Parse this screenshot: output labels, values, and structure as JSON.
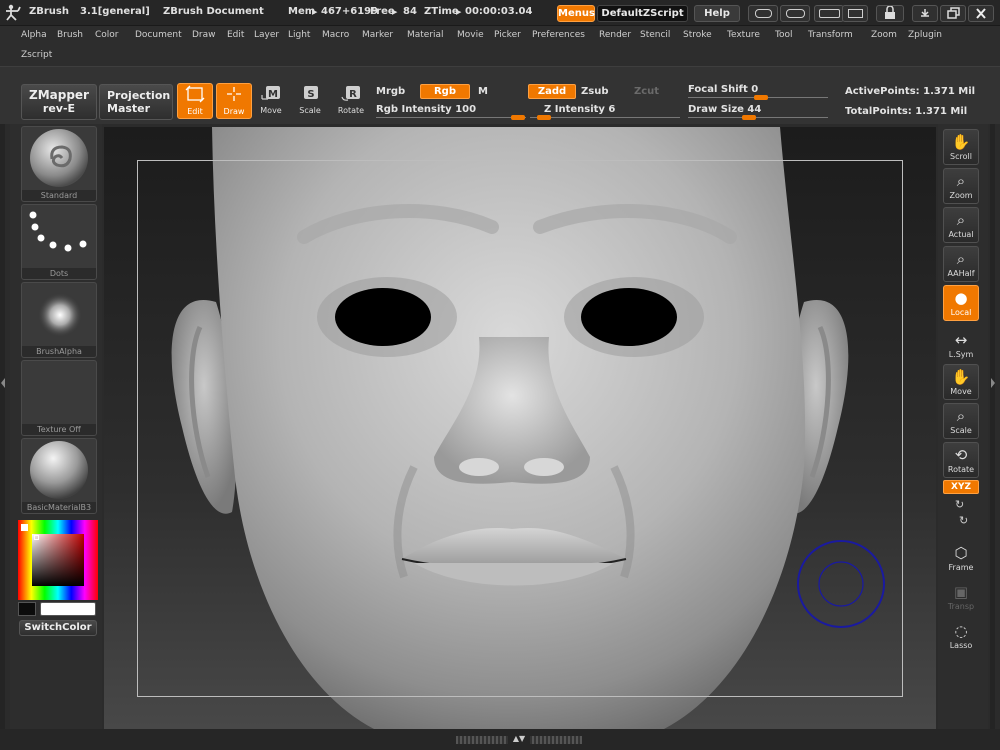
{
  "titlebar": {
    "app": "ZBrush",
    "version": "3.1[general]",
    "document": "ZBrush Document",
    "mem_label": "Mem",
    "mem_value": "467+6199",
    "free_label": "Free",
    "free_value": "84",
    "ztime_label": "ZTime",
    "ztime_value": "00:00:03.04",
    "menus_btn": "Menus",
    "script_btn": "DefaultZScript",
    "help_btn": "Help"
  },
  "menu": {
    "items": [
      "Alpha",
      "Brush",
      "Color",
      "Document",
      "Draw",
      "Edit",
      "Layer",
      "Light",
      "Macro",
      "Marker",
      "Material",
      "Movie",
      "Picker",
      "Preferences",
      "Render",
      "Stencil",
      "Stroke",
      "Texture",
      "Tool",
      "Transform",
      "Zoom",
      "Zplugin",
      "Zscript"
    ]
  },
  "shelf": {
    "zmapper": {
      "line1": "ZMapper",
      "line2": "rev-E"
    },
    "projection": {
      "line1": "Projection",
      "line2": "Master"
    },
    "tools": [
      {
        "label": "Edit",
        "active": true,
        "glyph": "✎"
      },
      {
        "label": "Draw",
        "active": true,
        "glyph": "✛"
      },
      {
        "label": "Move",
        "active": false,
        "glyph": "M"
      },
      {
        "label": "Scale",
        "active": false,
        "glyph": "S"
      },
      {
        "label": "Rotate",
        "active": false,
        "glyph": "R"
      }
    ],
    "mrgb": "Mrgb",
    "rgb": "Rgb",
    "m": "M",
    "rgb_intensity_label": "Rgb Intensity",
    "rgb_intensity_value": "100",
    "zadd": "Zadd",
    "zsub": "Zsub",
    "zcut": "Zcut",
    "z_intensity_label": "Z Intensity",
    "z_intensity_value": "6",
    "focal_shift_label": "Focal Shift",
    "focal_shift_value": "0",
    "draw_size_label": "Draw Size",
    "draw_size_value": "44",
    "active_points_label": "ActivePoints:",
    "active_points_value": "1.371 Mil",
    "total_points_label": "TotalPoints:",
    "total_points_value": "1.371 Mil"
  },
  "left": {
    "thumbs": [
      "Standard",
      "Dots",
      "BrushAlpha",
      "Texture Off",
      "BasicMaterialB3"
    ],
    "switch_color": "SwitchColor",
    "colors": {
      "main": "#0c0c0c",
      "secondary": "#ffffff",
      "picked": "#9a1010"
    }
  },
  "right": {
    "tools": [
      {
        "label": "Scroll",
        "icon": "hand-scroll-icon",
        "state": "normal"
      },
      {
        "label": "Zoom",
        "icon": "zoom-icon",
        "state": "normal"
      },
      {
        "label": "Actual",
        "icon": "actual-size-icon",
        "state": "normal"
      },
      {
        "label": "AAHalf",
        "icon": "aahalf-icon",
        "state": "normal"
      },
      {
        "label": "Local",
        "icon": "local-icon",
        "state": "active"
      },
      {
        "label": "L.Sym",
        "icon": "local-symmetry-icon",
        "state": "plain"
      },
      {
        "label": "Move",
        "icon": "move-icon",
        "state": "normal"
      },
      {
        "label": "Scale",
        "icon": "scale-icon",
        "state": "normal"
      },
      {
        "label": "Rotate",
        "icon": "rotate-icon",
        "state": "normal"
      },
      {
        "label": "Frame",
        "icon": "frame-icon",
        "state": "plain"
      },
      {
        "label": "Transp",
        "icon": "transparency-icon",
        "state": "disabled"
      },
      {
        "label": "Lasso",
        "icon": "lasso-icon",
        "state": "plain"
      }
    ],
    "xyz": "XYZ"
  },
  "colors": {
    "accent": "#f07800",
    "background": "#2b2b2b",
    "brush_cursor": "#1a1aa0"
  }
}
